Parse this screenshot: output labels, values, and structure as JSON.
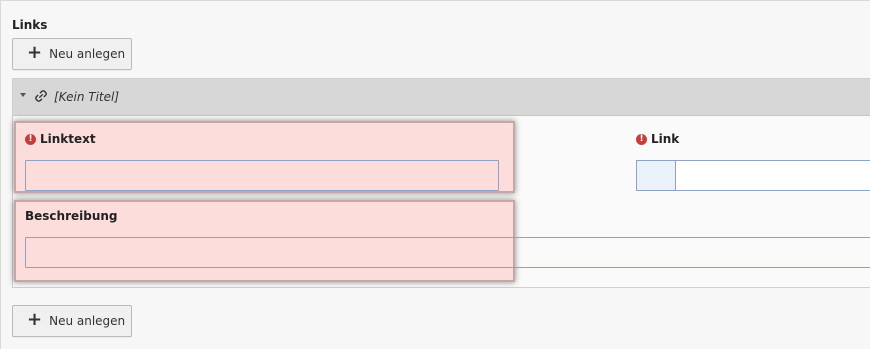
{
  "section": {
    "title": "Links"
  },
  "buttons": {
    "new_label": "Neu anlegen",
    "plus_icon": "+"
  },
  "record": {
    "title": "[Kein Titel]",
    "icons": {
      "collapse": "caret-down-icon",
      "link": "link-icon"
    }
  },
  "fields": {
    "linktext": {
      "label": "Linktext",
      "value": "",
      "error": true
    },
    "link": {
      "label": "Link",
      "value": "",
      "error": true
    },
    "beschreibung": {
      "label": "Beschreibung",
      "value": ""
    }
  },
  "colors": {
    "error": "#c83c3c",
    "highlight_bg": "#fddcdc",
    "header_bg": "#d7d7d7",
    "input_border": "#8ea1c7"
  }
}
